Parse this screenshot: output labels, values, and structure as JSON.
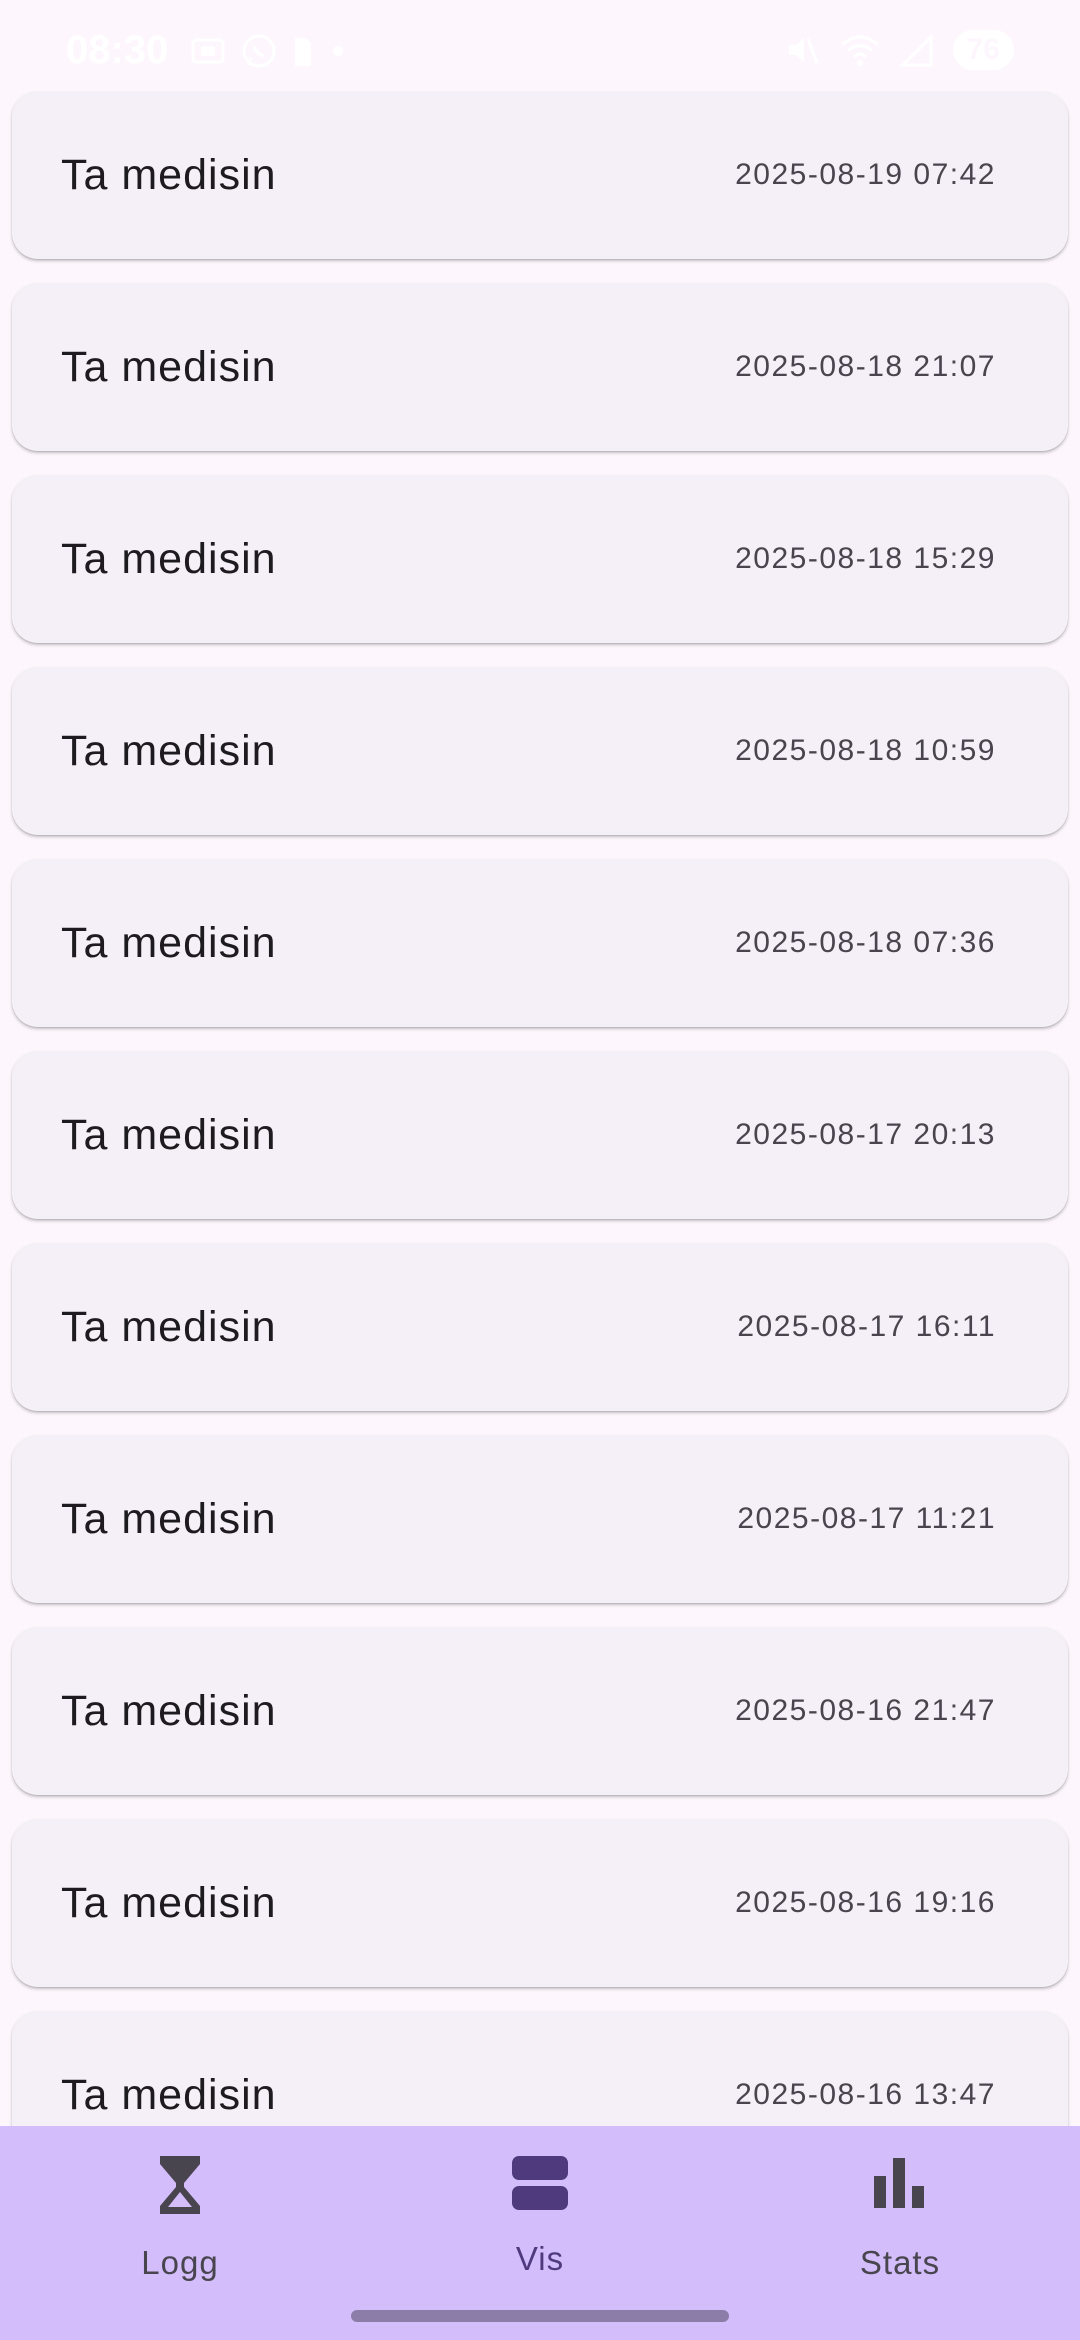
{
  "status_bar": {
    "time": "08:30",
    "battery": "76"
  },
  "log_entries": [
    {
      "title": "Ta medisin",
      "timestamp": "2025-08-19 07:42"
    },
    {
      "title": "Ta medisin",
      "timestamp": "2025-08-18 21:07"
    },
    {
      "title": "Ta medisin",
      "timestamp": "2025-08-18 15:29"
    },
    {
      "title": "Ta medisin",
      "timestamp": "2025-08-18 10:59"
    },
    {
      "title": "Ta medisin",
      "timestamp": "2025-08-18 07:36"
    },
    {
      "title": "Ta medisin",
      "timestamp": "2025-08-17 20:13"
    },
    {
      "title": "Ta medisin",
      "timestamp": "2025-08-17 16:11"
    },
    {
      "title": "Ta medisin",
      "timestamp": "2025-08-17 11:21"
    },
    {
      "title": "Ta medisin",
      "timestamp": "2025-08-16 21:47"
    },
    {
      "title": "Ta medisin",
      "timestamp": "2025-08-16 19:16"
    },
    {
      "title": "Ta medisin",
      "timestamp": "2025-08-16 13:47"
    }
  ],
  "bottom_nav": {
    "items": [
      {
        "label": "Logg",
        "icon": "hourglass-icon",
        "selected": false
      },
      {
        "label": "Vis",
        "icon": "view-agenda-icon",
        "selected": true
      },
      {
        "label": "Stats",
        "icon": "bar-chart-icon",
        "selected": false
      }
    ]
  },
  "colors": {
    "background": "#FDF7FD",
    "card": "#F5F0F7",
    "nav_background": "#D3BEFB",
    "selected_icon": "#4F3A7E",
    "icon": "#49454F"
  }
}
